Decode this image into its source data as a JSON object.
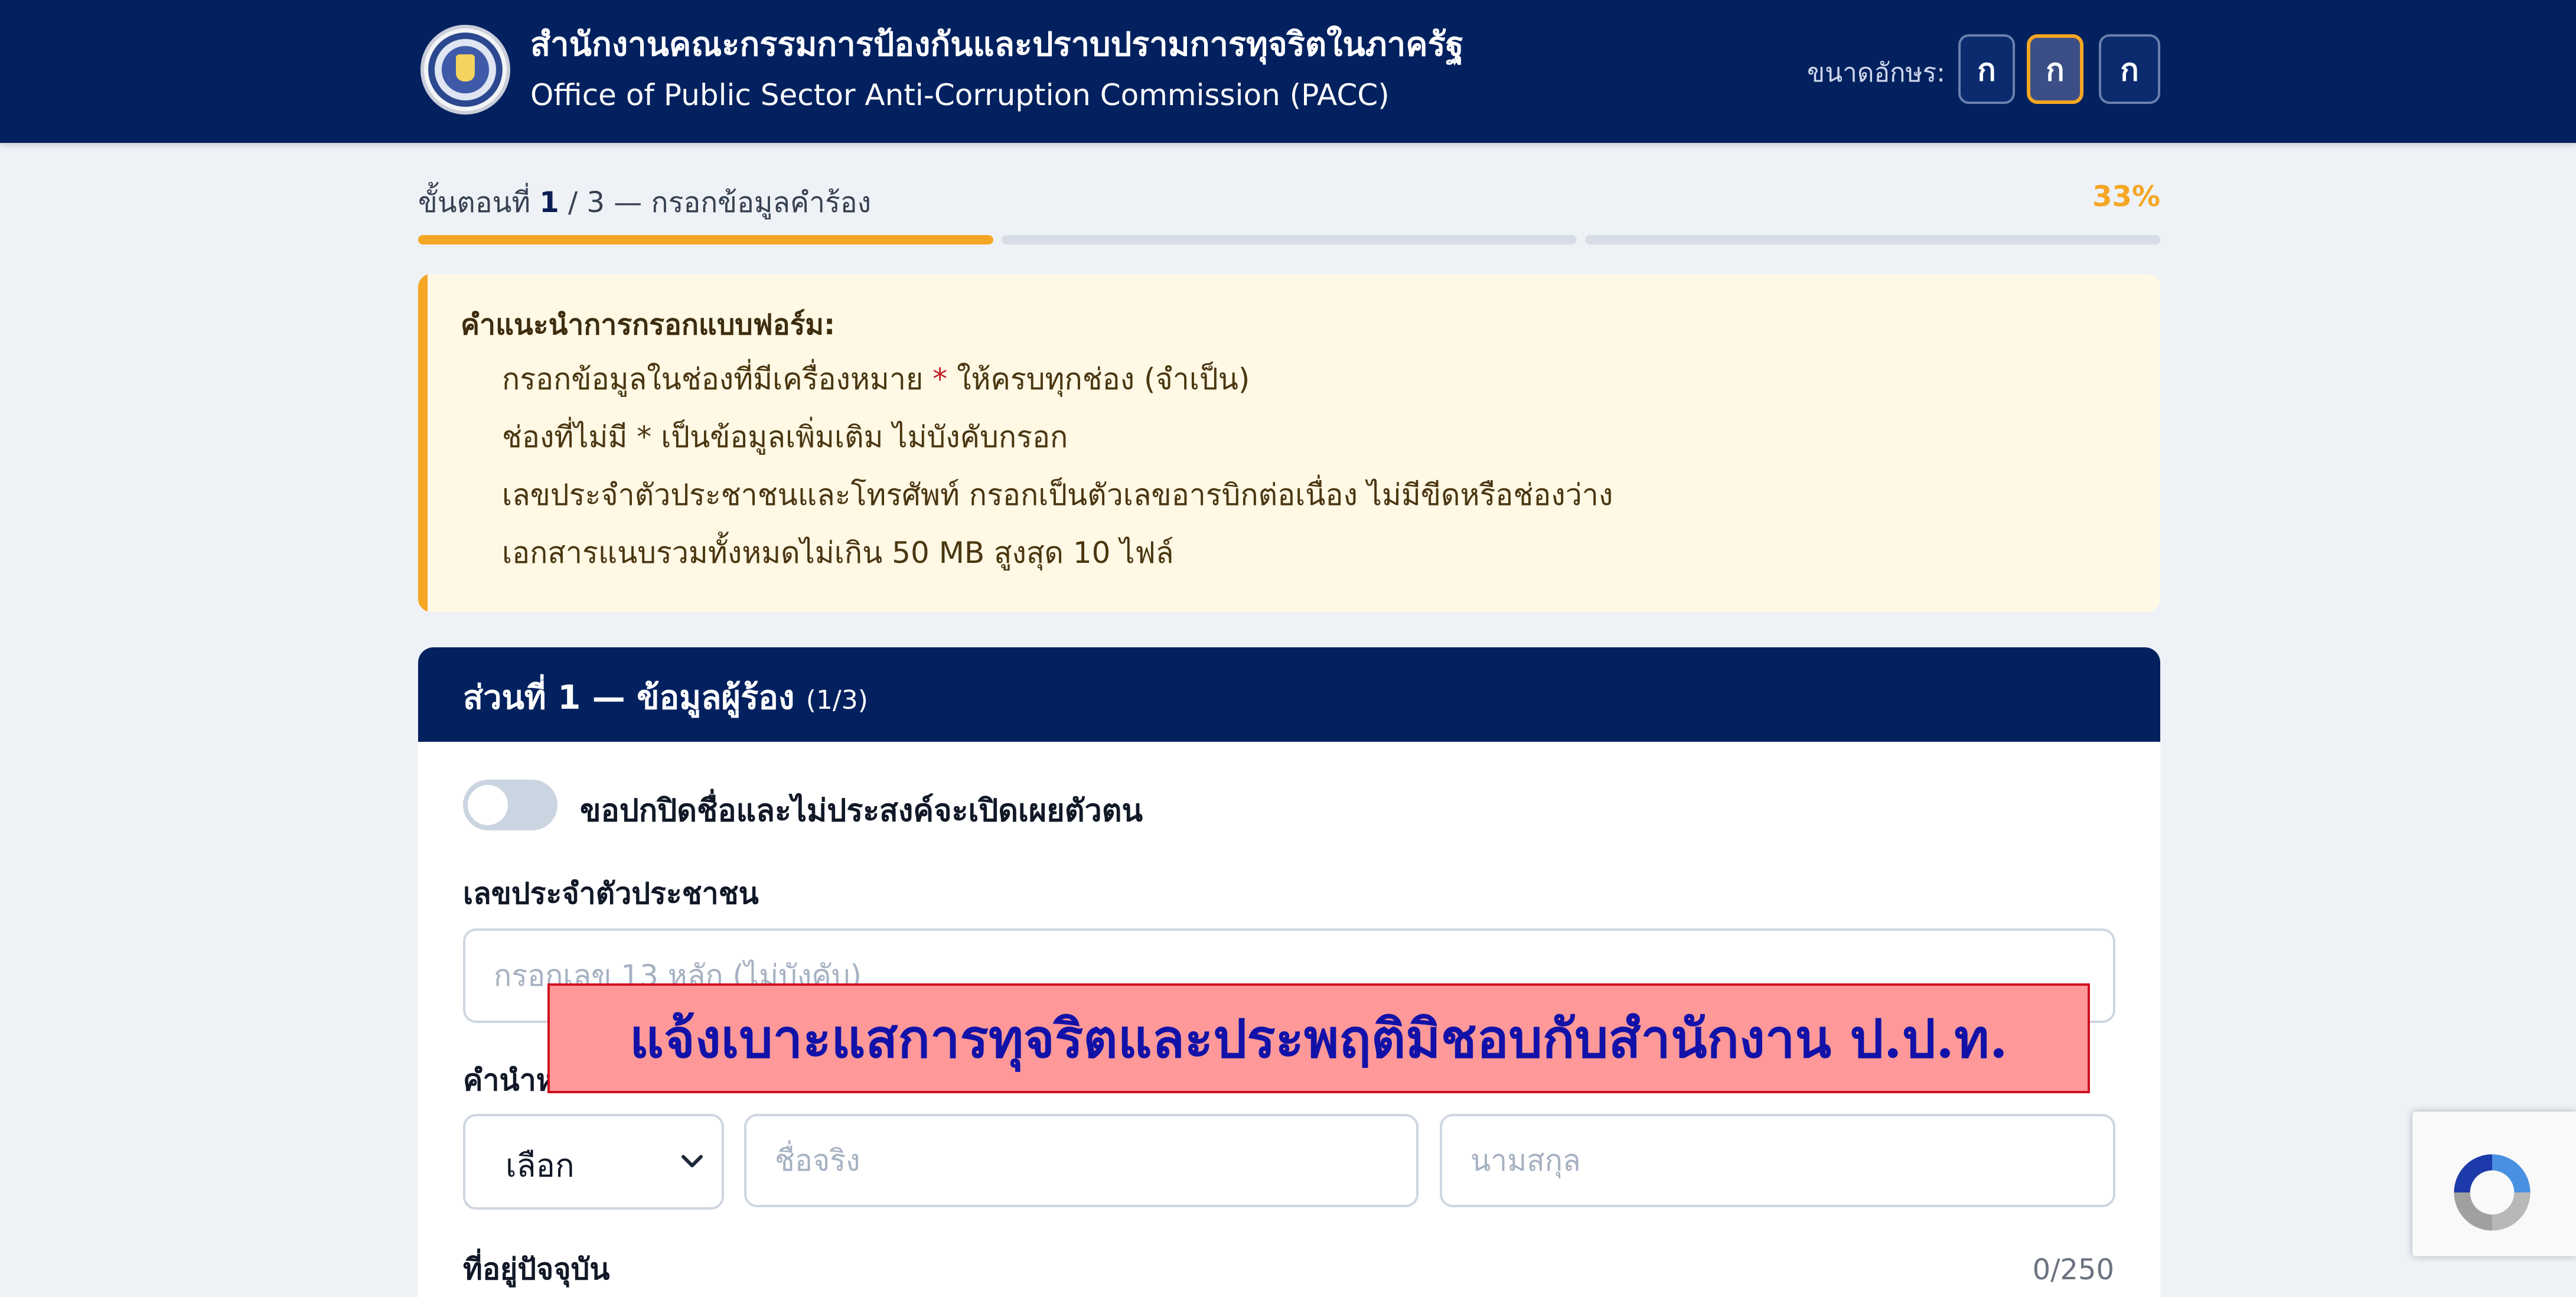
{
  "header": {
    "org_name_th": "สำนักงานคณะกรรมการป้องกันและปราบปรามการทุจริตในภาครัฐ",
    "org_name_en": "Office of Public Sector Anti-Corruption Commission (PACC)",
    "font_size_label": "ขนาดอักษร:",
    "font_size_buttons": [
      "ก",
      "ก",
      "ก"
    ],
    "active_font_size_index": 1
  },
  "progress": {
    "step_prefix": "ขั้นตอนที่",
    "current_step": "1",
    "separator": "/",
    "total_steps": "3",
    "step_name": "— กรอกข้อมูลคำร้อง",
    "percent_label": "33%",
    "fraction_complete": 0.333
  },
  "instructions": {
    "title": "คำแนะนำการกรอกแบบฟอร์ม:",
    "line1_before": "กรอกข้อมูลในช่องที่มีเครื่องหมาย",
    "asterisk": "*",
    "line1_after": "ให้ครบทุกช่อง (จำเป็น)",
    "line2": "ช่องที่ไม่มี * เป็นข้อมูลเพิ่มเติม ไม่บังคับกรอก",
    "line3": "เลขประจำตัวประชาชนและโทรศัพท์ กรอกเป็นตัวเลขอารบิกต่อเนื่อง ไม่มีขีดหรือช่องว่าง",
    "line4": "เอกสารแนบรวมทั้งหมดไม่เกิน 50 MB สูงสุด 10 ไฟล์"
  },
  "section": {
    "title": "ส่วนที่ 1 — ข้อมูลผู้ร้อง",
    "subtitle": "(1/3)",
    "anonymous_toggle_label": "ขอปกปิดชื่อและไม่ประสงค์จะเปิดเผยตัวตน",
    "anonymous_on": false,
    "id_label": "เลขประจำตัวประชาชน",
    "id_placeholder": "กรอกเลข 13 หลัก (ไม่บังคับ)",
    "prefix_label": "คำนำหน้า",
    "prefix_value": "เลือก",
    "firstname_placeholder": "ชื่อจริง",
    "lastname_placeholder": "นามสกุล",
    "address_label": "ที่อยู่ปัจจุบัน",
    "address_counter": "0/250"
  },
  "overlay_banner": "แจ้งเบาะแสการทุจริตและประพฤติมิชอบกับสำนักงาน ป.ป.ท.",
  "colors": {
    "header_bg": "#03215f",
    "accent": "#f5a623",
    "required": "#c2202c",
    "note_bg": "#fff8e5",
    "banner_bg": "#ff9999",
    "banner_text": "#1212a8"
  }
}
